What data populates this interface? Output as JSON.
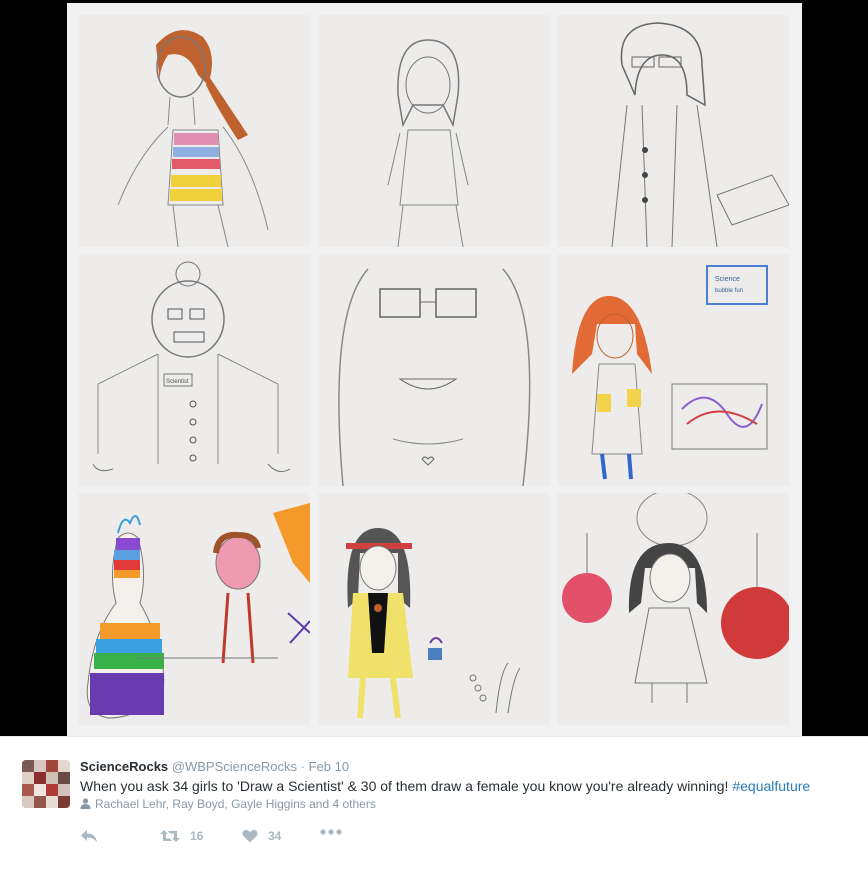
{
  "tweet": {
    "fullname": "ScienceRocks",
    "username": "@WBPScienceRocks",
    "separator": "·",
    "time": "Feb 10",
    "text": "When you ask 34 girls to 'Draw a Scientist' & 30 of them draw a female you know you're already winning! ",
    "hashtag": "#equalfuture",
    "tagged": "Rachael Lehr, Ray Boyd, Gayle Higgins and 4 others",
    "retweets": "16",
    "likes": "34"
  },
  "drawing_labels": {
    "badge": "Scientist",
    "poster": "Science",
    "poster_sub": "bubble fun"
  },
  "colors": {
    "accent": "#2b7bb9",
    "action_gray": "#aab8c2",
    "meta_gray": "#8899a6"
  },
  "icons": [
    "reply-icon",
    "retweet-icon",
    "like-icon",
    "more-icon",
    "person-icon"
  ]
}
